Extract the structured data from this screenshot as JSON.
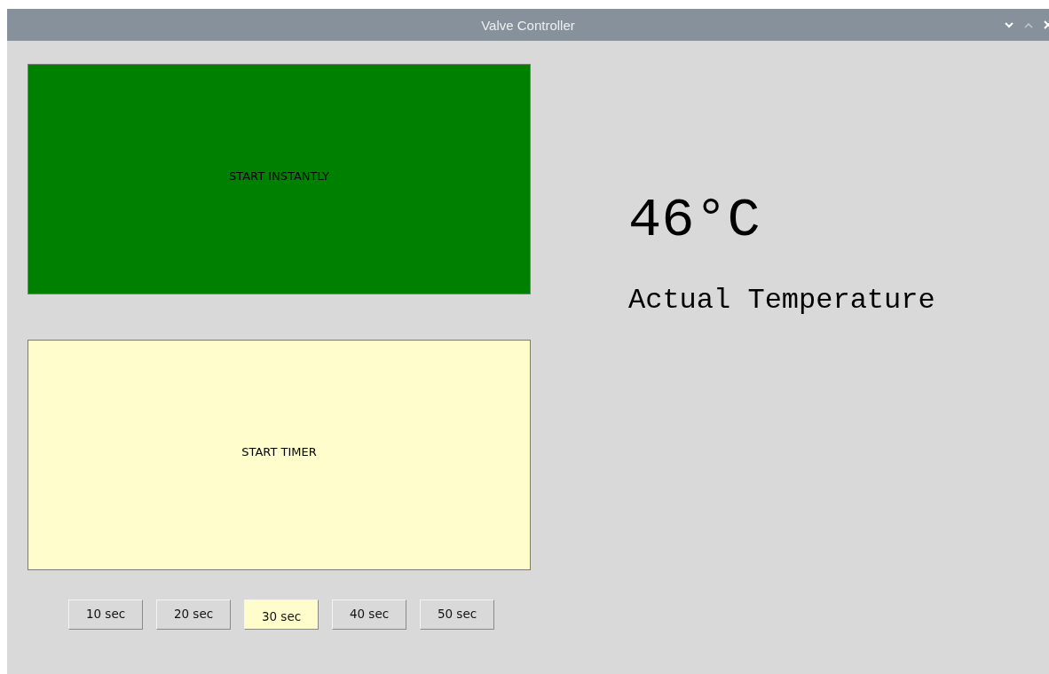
{
  "window": {
    "title": "Valve Controller"
  },
  "actions": [
    {
      "label": "START INSTANTLY",
      "color": "#008000"
    },
    {
      "label": "START TIMER",
      "color": "#fffdcc"
    }
  ],
  "timer_options": [
    {
      "label": "10 sec",
      "selected": false
    },
    {
      "label": "20 sec",
      "selected": false
    },
    {
      "label": "30 sec",
      "selected": true
    },
    {
      "label": "40 sec",
      "selected": false
    },
    {
      "label": "50 sec",
      "selected": false
    }
  ],
  "temperature": {
    "value": "46°C",
    "caption": "Actual Temperature"
  }
}
